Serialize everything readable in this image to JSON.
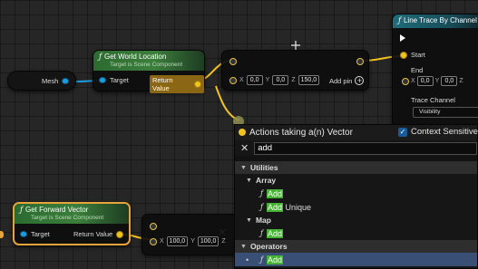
{
  "mesh_node": {
    "label": "Mesh"
  },
  "get_world_location": {
    "title": "Get World Location",
    "subtitle": "Target is Scene Component",
    "target_label": "Target",
    "return_label": "Return Value"
  },
  "add_node_top": {
    "x_label": "X",
    "x_value": "0,0",
    "y_label": "Y",
    "y_value": "0,0",
    "z_label": "Z",
    "z_value": "150,0",
    "add_pin_label": "Add pin"
  },
  "line_trace": {
    "title": "Line Trace By Channel",
    "start_label": "Start",
    "end_label": "End",
    "x_label": "X",
    "x_value": "0,0",
    "y_label": "Y",
    "y_value": "0,0",
    "z_label": "Z",
    "trace_channel_label": "Trace Channel",
    "trace_channel_value": "Visibility"
  },
  "get_forward_vector": {
    "title": "Get Forward Vector",
    "subtitle": "Target is Scene Component",
    "target_label": "Target",
    "return_label": "Return Value"
  },
  "multiply_node": {
    "x_label": "X",
    "x_value": "100,0",
    "y_label": "Y",
    "y_value": "100,0",
    "z_label": "Z"
  },
  "menu": {
    "title": "Actions taking a(n) Vector",
    "context_sensitive_label": "Context Sensitive",
    "search_value": "add",
    "categories": [
      {
        "label": "Utilities"
      },
      {
        "label": "Array"
      },
      {
        "label": "Map"
      },
      {
        "label": "Operators"
      }
    ],
    "items": [
      {
        "match": "Add",
        "rest": ""
      },
      {
        "match": "Add",
        "rest": " Unique"
      },
      {
        "match": "Add",
        "rest": ""
      },
      {
        "match": "Add",
        "rest": ""
      }
    ]
  },
  "colors": {
    "object_pin": "#1b9dde",
    "vector_pin": "#f2c21f",
    "highlight": "#44b332",
    "selection": "#e6a43a"
  },
  "icons": [
    "function-icon",
    "plus-icon",
    "close-icon",
    "checkmark-icon",
    "triangle-expand-icon",
    "exec-pin-icon",
    "move-cursor-icon"
  ]
}
